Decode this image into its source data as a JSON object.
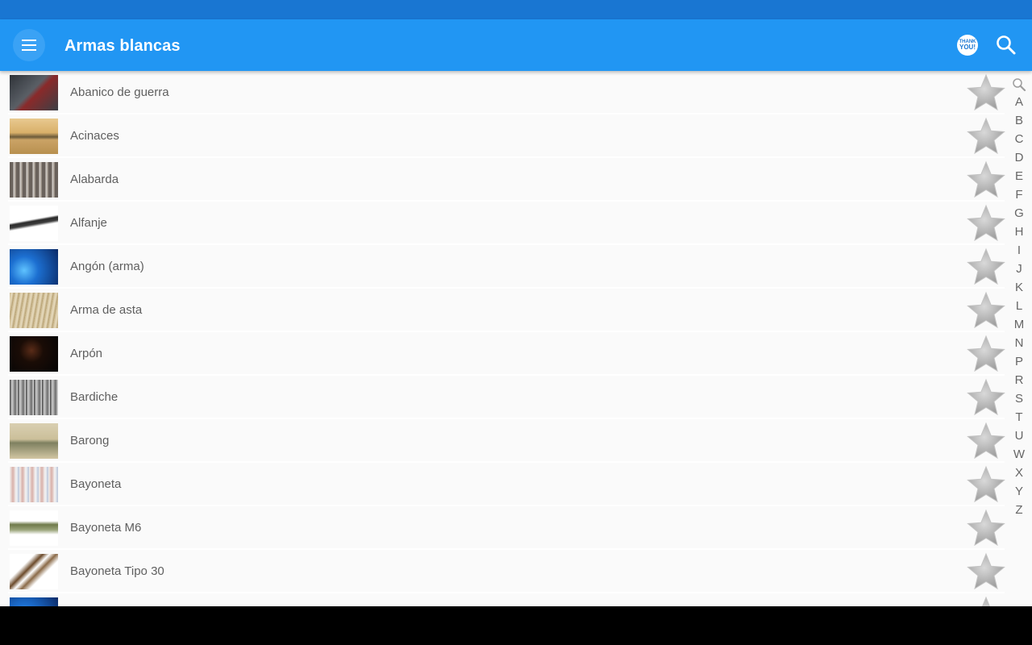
{
  "app": {
    "title": "Armas blancas",
    "thanks_badge": [
      "THANK",
      "YOU!"
    ]
  },
  "colors": {
    "status_bar": "#1976d2",
    "app_bar": "#2196f3",
    "list_background": "#fafafa",
    "star": "#bdbdbd"
  },
  "icons": {
    "menu": "hamburger-icon",
    "thanks": "thank-you-icon",
    "search": "search-icon",
    "favorite": "star-icon",
    "index_search": "magnifier-icon"
  },
  "items": [
    {
      "label": "Abanico de guerra",
      "thumb": "dark-grey"
    },
    {
      "label": "Acinaces",
      "thumb": "tan"
    },
    {
      "label": "Alabarda",
      "thumb": "grey-brown"
    },
    {
      "label": "Alfanje",
      "thumb": "white"
    },
    {
      "label": "Angón (arma)",
      "thumb": "blue"
    },
    {
      "label": "Arma de asta",
      "thumb": "beige"
    },
    {
      "label": "Arpón",
      "thumb": "black"
    },
    {
      "label": "Bardiche",
      "thumb": "grey"
    },
    {
      "label": "Barong",
      "thumb": "khaki"
    },
    {
      "label": "Bayoneta",
      "thumb": "light"
    },
    {
      "label": "Bayoneta M6",
      "thumb": "olive"
    },
    {
      "label": "Bayoneta Tipo 30",
      "thumb": "white-brown"
    },
    {
      "label": "",
      "thumb": "blue"
    }
  ],
  "index_letters": [
    "A",
    "B",
    "C",
    "D",
    "E",
    "F",
    "G",
    "H",
    "I",
    "J",
    "K",
    "L",
    "M",
    "N",
    "P",
    "R",
    "S",
    "T",
    "U",
    "W",
    "X",
    "Y",
    "Z"
  ]
}
